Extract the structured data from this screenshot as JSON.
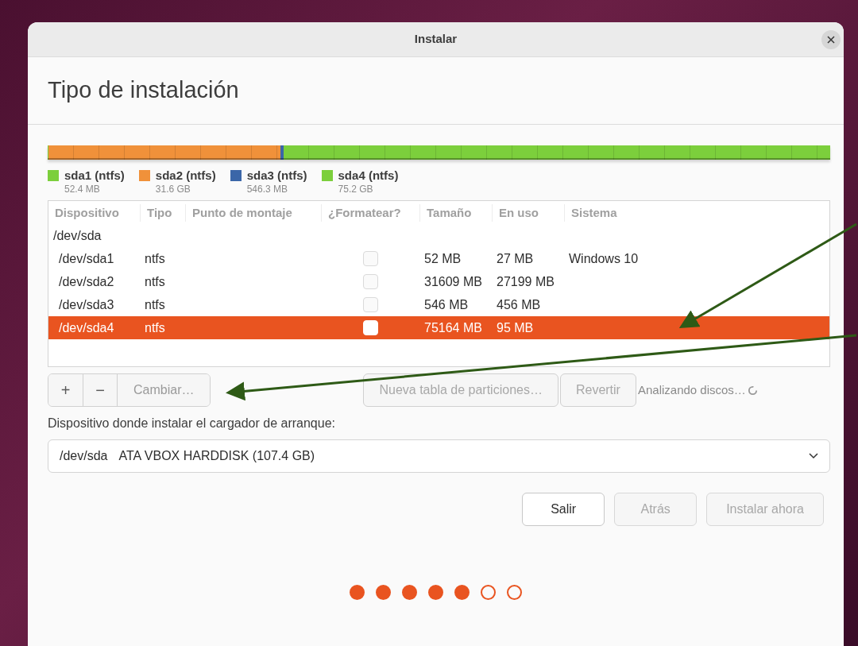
{
  "window": {
    "title": "Instalar"
  },
  "heading": "Tipo de instalación",
  "partitions": [
    {
      "name": "sda1 (ntfs)",
      "size": "52.4 MB",
      "color": "#7ccf3c",
      "level": 0.001
    },
    {
      "name": "sda2 (ntfs)",
      "size": "31.6 GB",
      "color": "#f0913a",
      "level": 0.296
    },
    {
      "name": "sda3 (ntfs)",
      "size": "546.3 MB",
      "color": "#3b66a8",
      "level": 0.005
    },
    {
      "name": "sda4 (ntfs)",
      "size": "75.2 GB",
      "color": "#7ccf3c",
      "level": 0.698
    }
  ],
  "table": {
    "columns": [
      "Dispositivo",
      "Tipo",
      "Punto de montaje",
      "¿Formatear?",
      "Tamaño",
      "En uso",
      "Sistema"
    ],
    "disk": "/dev/sda",
    "rows": [
      {
        "device": "/dev/sda1",
        "type": "ntfs",
        "size": "52 MB",
        "used": "27 MB",
        "system": "Windows 10",
        "checked": false,
        "selected": false
      },
      {
        "device": "/dev/sda2",
        "type": "ntfs",
        "size": "31609 MB",
        "used": "27199 MB",
        "checked": false,
        "selected": false
      },
      {
        "device": "/dev/sda3",
        "type": "ntfs",
        "size": "546 MB",
        "used": "456 MB",
        "checked": false,
        "selected": false
      },
      {
        "device": "/dev/sda4",
        "type": "ntfs",
        "size": "75164 MB",
        "used": "95 MB",
        "checked": false,
        "selected": true
      }
    ]
  },
  "edit_buttons": [
    {
      "label": "+",
      "disabled": false
    },
    {
      "label": "−",
      "disabled": false
    },
    {
      "label": "Cambiar…",
      "disabled": true
    }
  ],
  "table_buttons": [
    {
      "label": "Nueva tabla de particiones…",
      "disabled": true
    },
    {
      "label": "Revertir",
      "disabled": true
    }
  ],
  "status": "Analizando discos…",
  "bootloader": {
    "label": "Dispositivo donde instalar el cargador de arranque:",
    "device": "/dev/sda",
    "description": "ATA VBOX HARDDISK (107.4 GB)"
  },
  "buttons": [
    {
      "label": "Salir",
      "disabled": false
    },
    {
      "label": "Atrás",
      "disabled": true
    },
    {
      "label": "Instalar ahora",
      "disabled": true
    }
  ],
  "steps": [
    {
      "done": true
    },
    {
      "done": true
    },
    {
      "done": true
    },
    {
      "done": true
    },
    {
      "done": true
    },
    {
      "done": false
    },
    {
      "done": false
    }
  ]
}
